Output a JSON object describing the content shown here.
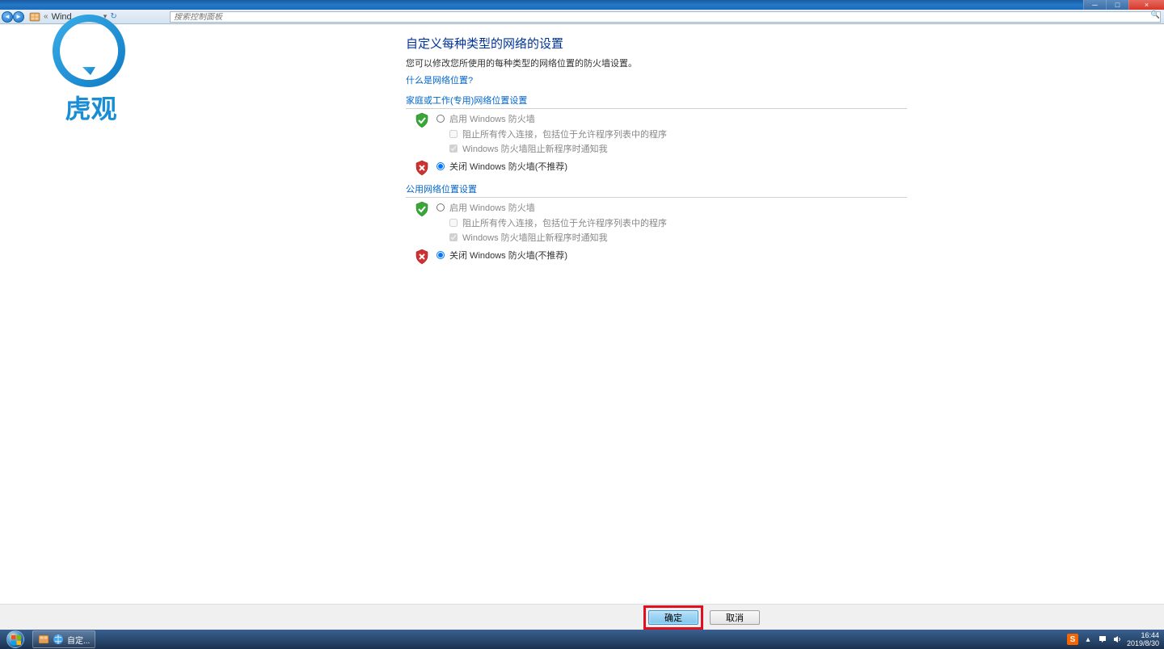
{
  "titlebar": {
    "min_label": "─",
    "max_label": "□",
    "close_label": "×"
  },
  "nav": {
    "breadcrumb_prefix": "«",
    "breadcrumb_item": "Wind...",
    "dropdown_marker": "▾",
    "refresh_glyph": "↻",
    "search_placeholder": "搜索控制面板",
    "search_icon": "🔍"
  },
  "watermark": {
    "text": "虎观"
  },
  "page": {
    "title": "自定义每种类型的网络的设置",
    "subtitle": "您可以修改您所使用的每种类型的网络位置的防火墙设置。",
    "help_link": "什么是网络位置?"
  },
  "sections": {
    "private": {
      "header": "家庭或工作(专用)网络位置设置",
      "enable_label": "启用 Windows 防火墙",
      "block_all_label": "阻止所有传入连接，包括位于允许程序列表中的程序",
      "notify_label": "Windows 防火墙阻止新程序时通知我",
      "disable_label": "关闭 Windows 防火墙(不推荐)"
    },
    "public": {
      "header": "公用网络位置设置",
      "enable_label": "启用 Windows 防火墙",
      "block_all_label": "阻止所有传入连接，包括位于允许程序列表中的程序",
      "notify_label": "Windows 防火墙阻止新程序时通知我",
      "disable_label": "关闭 Windows 防火墙(不推荐)"
    }
  },
  "footer": {
    "ok_label": "确定",
    "cancel_label": "取消"
  },
  "taskbar": {
    "task_label": "自定...",
    "time": "16:44",
    "date": "2019/8/30",
    "tray_sogou": "S",
    "tray_arrow": "▴"
  }
}
